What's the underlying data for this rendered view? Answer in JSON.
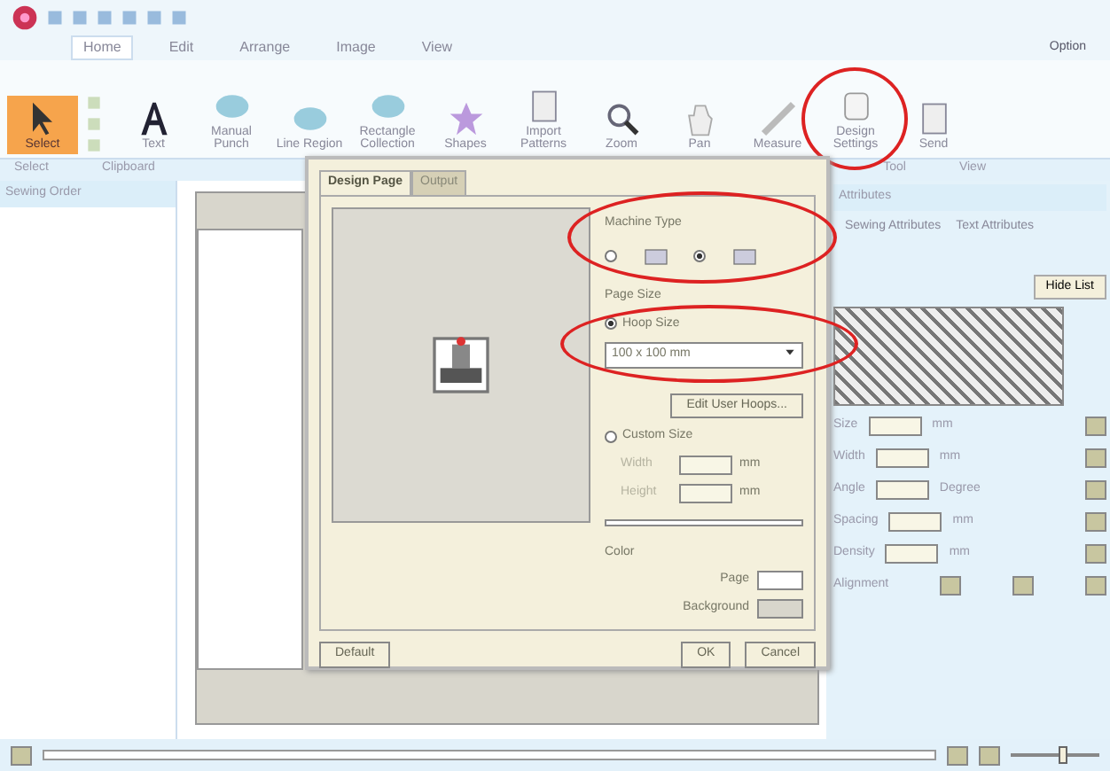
{
  "ribbon": {
    "tabs": [
      {
        "label": "Home",
        "selected": true
      },
      {
        "label": "Edit",
        "selected": false
      },
      {
        "label": "Arrange",
        "selected": false
      },
      {
        "label": "Image",
        "selected": false
      },
      {
        "label": "View",
        "selected": false
      }
    ],
    "option": "Option",
    "tools": [
      {
        "label": "Select",
        "kind": "arrow",
        "selected": true
      },
      {
        "label": "Text",
        "kind": "letter",
        "selected": false
      },
      {
        "label": "Manual Punch",
        "kind": "blob",
        "selected": false
      },
      {
        "label": "Line Region",
        "kind": "blob",
        "selected": false
      },
      {
        "label": "Rectangle Collection",
        "kind": "blob",
        "selected": false
      },
      {
        "label": "Shapes",
        "kind": "star",
        "selected": false
      },
      {
        "label": "Import Patterns",
        "kind": "doc",
        "selected": false
      },
      {
        "label": "Zoom",
        "kind": "lens",
        "selected": false
      },
      {
        "label": "Pan",
        "kind": "hand",
        "selected": false
      },
      {
        "label": "Measure",
        "kind": "ruler",
        "selected": false
      },
      {
        "label": "Design Settings",
        "kind": "page",
        "selected": false
      },
      {
        "label": "Send",
        "kind": "doc",
        "selected": false
      }
    ],
    "groups": [
      "Select",
      "Clipboard",
      "Tool",
      "View"
    ]
  },
  "sewing_order": {
    "title": "Sewing Order"
  },
  "status_bar": {
    "zoom_slider": {
      "level": 0.6
    }
  },
  "attributes": {
    "title": "Attributes",
    "tabs": [
      {
        "label": "Sewing Attributes",
        "selected": false
      },
      {
        "label": "Text Attributes",
        "selected": false
      }
    ],
    "hide_button": "Hide List",
    "rows": [
      {
        "label": "Size",
        "unit": "mm"
      },
      {
        "label": "Width",
        "unit": "mm"
      },
      {
        "label": "Angle",
        "unit": "Degree"
      },
      {
        "label": "Spacing",
        "unit": "mm"
      },
      {
        "label": "Density",
        "unit": "mm"
      }
    ],
    "alignment": "Alignment"
  },
  "dialog": {
    "tabs": [
      {
        "label": "Design Page",
        "selected": true
      },
      {
        "label": "Output",
        "selected": false
      }
    ],
    "machine_type_label": "Machine Type",
    "machine_types": [
      {
        "selected": false
      },
      {
        "selected": true
      }
    ],
    "page_size_label": "Page Size",
    "hoop_size": {
      "label": "Hoop Size",
      "selected": true,
      "value": "100 x 100 mm"
    },
    "edit_hoops": "Edit User Hoops...",
    "custom_size": {
      "label": "Custom Size",
      "selected": false,
      "fields": [
        {
          "label": "Width",
          "unit": "mm"
        },
        {
          "label": "Height",
          "unit": "mm"
        }
      ]
    },
    "color_label": "Color",
    "colors": [
      {
        "label": "Page",
        "color": "#ffffff"
      },
      {
        "label": "Background",
        "color": "#d8d6cc"
      }
    ],
    "default": "Default",
    "ok": "OK",
    "cancel": "Cancel"
  }
}
